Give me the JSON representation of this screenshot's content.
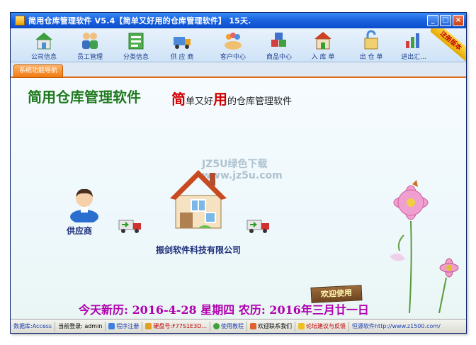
{
  "window": {
    "title": "简用仓库管理软件  V5.4【简单又好用的仓库管理软件】  15天.",
    "min": "_",
    "max": "□",
    "close": "×"
  },
  "toolbar": {
    "items": [
      {
        "label": "公司信息",
        "icon": "company-icon"
      },
      {
        "label": "员工管理",
        "icon": "staff-icon"
      },
      {
        "label": "分类信息",
        "icon": "category-icon"
      },
      {
        "label": "供 应 商",
        "icon": "supplier-icon"
      },
      {
        "label": "客户中心",
        "icon": "customer-icon"
      },
      {
        "label": "商品中心",
        "icon": "goods-icon"
      },
      {
        "label": "入 库 单",
        "icon": "inbound-icon"
      },
      {
        "label": "出 仓 单",
        "icon": "outbound-icon"
      },
      {
        "label": "进出汇...",
        "icon": "report-icon"
      }
    ],
    "badge": "注册版本"
  },
  "nav": {
    "tab": "系统功能导航"
  },
  "main": {
    "app_title": "简用仓库管理软件",
    "slogan": {
      "a": "简",
      "b": "单又好",
      "c": "用",
      "d": "的仓库管理软件"
    },
    "watermark_line1": "JZ5U绿色下载",
    "watermark_line2": "www.jz5u.com",
    "supplier_label": "供应商",
    "company_label": "振剑软件科技有限公司",
    "date_line": "今天新历: 2016-4-28 星期四  农历: 2016年三月廿一日",
    "welcome": "欢迎使用"
  },
  "status": {
    "db": "数据库:Access",
    "login": "当前登录: admin",
    "register": "程序注册",
    "disk": "硬盘号:F77S1E3D...",
    "tutorial": "使用教程",
    "contact": "欢迎联系我们",
    "forum": "论坛建议与反馈",
    "site": "恒源软件http://www.z1500.com/"
  },
  "colors": {
    "title_green": "#1f7a1f",
    "slogan_red": "#d20000",
    "date_magenta": "#b000b0",
    "nav_orange": "#f07a10"
  }
}
